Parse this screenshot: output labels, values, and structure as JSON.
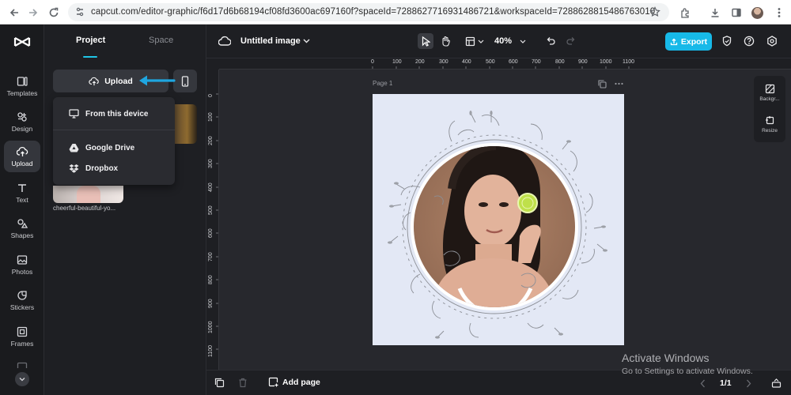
{
  "browser": {
    "url": "capcut.com/editor-graphic/f6d17d6b68194cf08fd3600ac697160f?spaceId=7288627716931486721&workspaceId=7288628815486763010"
  },
  "rail": {
    "items": [
      {
        "label": "Templates",
        "icon": "templates-icon"
      },
      {
        "label": "Design",
        "icon": "design-icon"
      },
      {
        "label": "Upload",
        "icon": "upload-cloud-icon",
        "active": true
      },
      {
        "label": "Text",
        "icon": "text-icon"
      },
      {
        "label": "Shapes",
        "icon": "shapes-icon"
      },
      {
        "label": "Photos",
        "icon": "photos-icon"
      },
      {
        "label": "Stickers",
        "icon": "stickers-icon"
      },
      {
        "label": "Frames",
        "icon": "frames-icon"
      }
    ]
  },
  "panel": {
    "tabs": [
      {
        "label": "Project",
        "active": true
      },
      {
        "label": "Space"
      }
    ],
    "upload_label": "Upload",
    "menu": [
      {
        "label": "From this device",
        "icon": "monitor-icon"
      },
      {
        "label": "Google Drive",
        "icon": "google-drive-icon"
      },
      {
        "label": "Dropbox",
        "icon": "dropbox-icon"
      }
    ],
    "thumbnail_name": "cheerful-beautiful-yo..."
  },
  "topbar": {
    "title": "Untitled image",
    "zoom": "40%",
    "export_label": "Export"
  },
  "rulers": {
    "horizontal": [
      "0",
      "100",
      "200",
      "300",
      "400",
      "500",
      "600",
      "700",
      "800",
      "900",
      "1000",
      "1100"
    ],
    "vertical": [
      "0",
      "100",
      "200",
      "300",
      "400",
      "500",
      "600",
      "700",
      "800",
      "900",
      "1000",
      "1100"
    ]
  },
  "canvas": {
    "page_label": "Page 1",
    "page_background": "#e3e8f5"
  },
  "dock": {
    "items": [
      {
        "label": "Backgr...",
        "icon": "background-icon"
      },
      {
        "label": "Resize",
        "icon": "resize-icon"
      }
    ]
  },
  "bottombar": {
    "add_page_label": "Add page",
    "pager": "1/1"
  },
  "watermark": {
    "title": "Activate Windows",
    "subtitle": "Go to Settings to activate Windows."
  },
  "colors": {
    "accent": "#17b9e8",
    "app_background": "#1e1f23"
  }
}
